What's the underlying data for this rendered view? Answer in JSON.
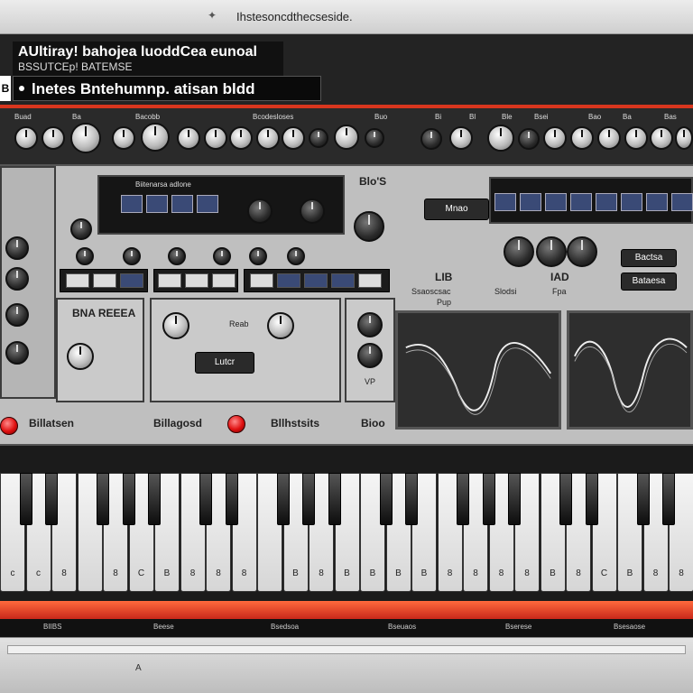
{
  "window": {
    "title": "Ihstesoncdthecseside."
  },
  "header": {
    "name_line1": "AUltiray! bahojea luoddCea eunoal",
    "name_line2": "BSSUTCEp! BATEMSE",
    "preset": "lnetes Bntehumnp. atisan bldd",
    "left_tab": "B"
  },
  "strip_labels": [
    "Buad",
    "Ba",
    "Bacobb",
    "Bcodesloses",
    "Buo",
    "Bi",
    "Bl",
    "Ble",
    "Bsei",
    "Bao",
    "Ba",
    "Bas"
  ],
  "panel": {
    "display_label": "Biitenarsa adlone",
    "top_right_label": "Blo'S",
    "mode_button": "Mnao",
    "lfo_label": "BNA REEEA",
    "vcf_label": "Reab",
    "center_button": "Lutcr",
    "vp_label": "VP",
    "bottom_labels": [
      "Billatsen",
      "Billagosd",
      "Bllhstsits",
      "Bioo"
    ],
    "right_button_1": "Bactsa",
    "right_button_2": "Bataesa",
    "mid_labels": [
      "Ssaoscsac",
      "Pup",
      "Slodsi",
      "Fpa"
    ],
    "section_lib": "LIB",
    "section_iad": "IAD"
  },
  "keys": {
    "labels": [
      "c",
      "c",
      "8",
      "",
      "8",
      "C",
      "B",
      "8",
      "8",
      "8",
      "",
      "B",
      "8",
      "B",
      "B",
      "B",
      "B",
      "8",
      "8",
      "8",
      "8",
      "B",
      "8",
      "C",
      "B",
      "8",
      "8"
    ]
  },
  "footer": {
    "labels": [
      "BIIBS",
      "Beese",
      "Bsedsoa",
      "Bseuaos",
      "Bserese",
      "Bsesaose"
    ]
  },
  "status": {
    "text": "A"
  },
  "colors": {
    "accent": "#d8361e",
    "led": "#e01010",
    "display_blue": "#3a4a76"
  }
}
